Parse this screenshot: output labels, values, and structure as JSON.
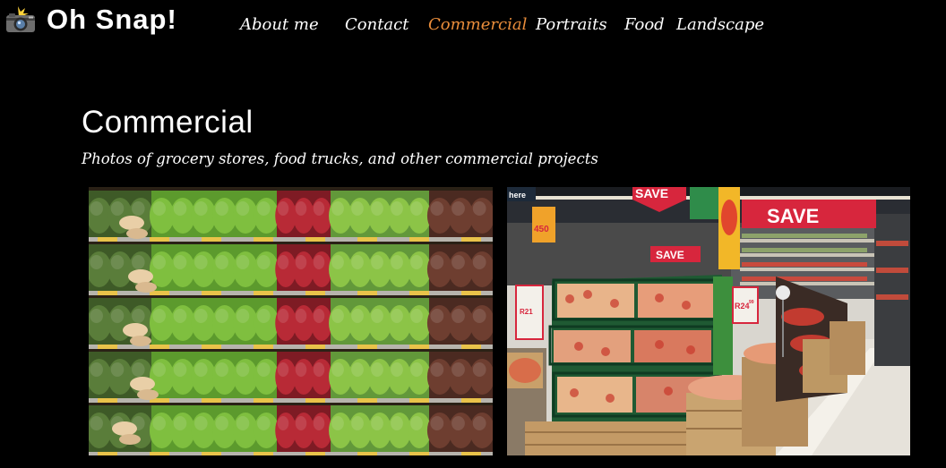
{
  "brand": {
    "title": "Oh Snap!",
    "icon": "camera-flash-icon"
  },
  "nav": {
    "items": [
      {
        "label": "About me",
        "active": false
      },
      {
        "label": "Contact",
        "active": false
      },
      {
        "label": "Commercial",
        "active": true
      },
      {
        "label": "Portraits",
        "active": false
      },
      {
        "label": "Food",
        "active": false
      },
      {
        "label": "Landscape",
        "active": false
      }
    ],
    "active_color": "#e98d3b"
  },
  "page": {
    "heading": "Commercial",
    "subtitle": "Photos of grocery stores, food trucks, and other commercial projects"
  },
  "photos": {
    "left": {
      "subject": "produce-shelves-photo"
    },
    "right": {
      "subject": "supermarket-aisle-photo",
      "signs": {
        "save_top": "SAVE",
        "save_right": "SAVE",
        "save_mid": "SAVE",
        "price_left": "450",
        "price_small": "R21",
        "price_big": "R24",
        "price_big_sup": "99",
        "here_label": "here"
      }
    }
  },
  "colors": {
    "background": "#000000",
    "text": "#ffffff",
    "accent": "#e98d3b"
  }
}
